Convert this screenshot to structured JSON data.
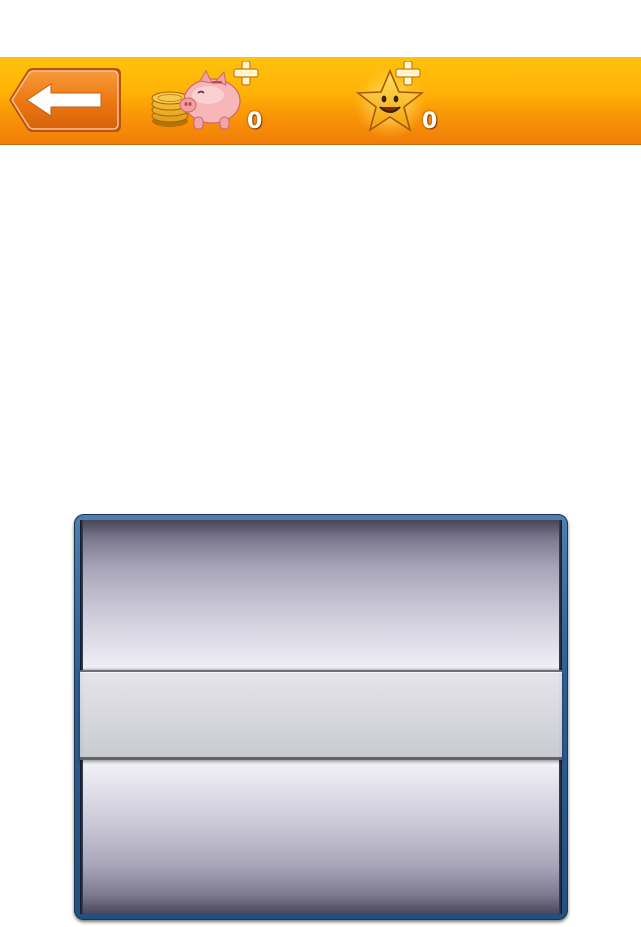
{
  "top_bar": {
    "coins_count": "0",
    "stars_count": "0",
    "icons": {
      "back": "left-arrow-icon",
      "coins": "piggy-bank-coins-icon",
      "stars": "smiling-star-icon",
      "add": "plus-icon"
    },
    "colors": {
      "bar_top": "#ffc20e",
      "bar_bottom": "#f07d08",
      "button": "#e8730c"
    }
  },
  "picker": {
    "selected_label": "",
    "colors": {
      "frame": "#2e5f92",
      "selection_bar": "#d8d8df"
    }
  }
}
